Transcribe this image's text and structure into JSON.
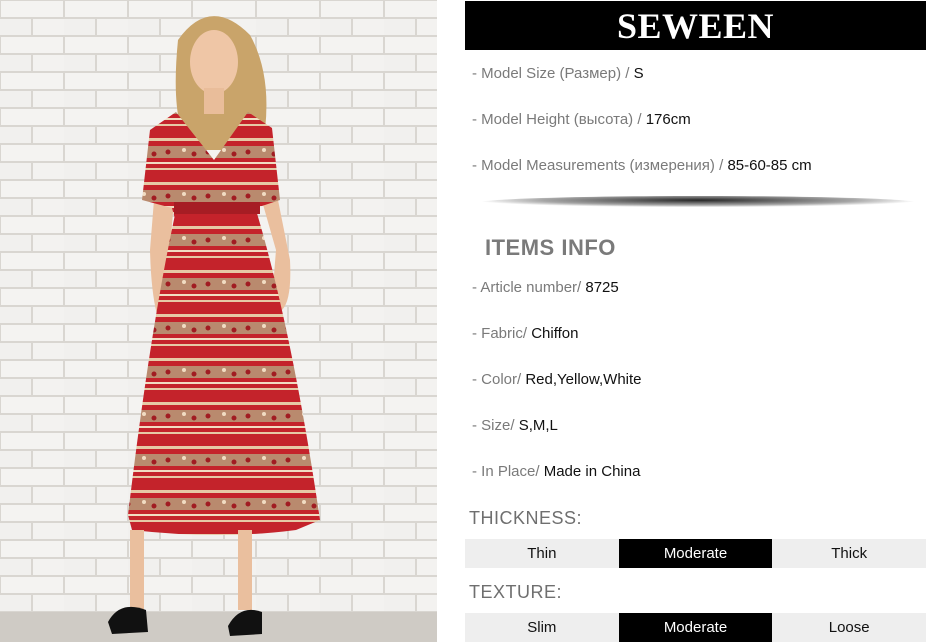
{
  "brand": "SEWEEN",
  "model_info": [
    {
      "label": "- Model Size (Размер) / ",
      "value": "S"
    },
    {
      "label": "- Model Height (высота) / ",
      "value": "176cm"
    },
    {
      "label": "- Model Measurements (измерения) / ",
      "value": "85-60-85 cm"
    }
  ],
  "items_info_title": "ITEMS INFO",
  "items_info": [
    {
      "label": "- Article number/ ",
      "value": "8725"
    },
    {
      "label": "- Fabric/ ",
      "value": "Chiffon"
    },
    {
      "label": "- Color/ ",
      "value": "Red,Yellow,White"
    },
    {
      "label": "- Size/ ",
      "value": "S,M,L"
    },
    {
      "label": "- In Place/ ",
      "value": "Made in China"
    }
  ],
  "thickness": {
    "title": "THICKNESS:",
    "options": [
      "Thin",
      "Moderate",
      "Thick"
    ],
    "selected": "Moderate"
  },
  "texture": {
    "title": "TEXTURE:",
    "options": [
      "Slim",
      "Moderate",
      "Loose"
    ],
    "selected": "Moderate"
  },
  "colors": {
    "bar": "#000000",
    "label_gray": "#7a7a7a",
    "option_bg": "#eeeeee",
    "dress_red": "#c4232b"
  }
}
